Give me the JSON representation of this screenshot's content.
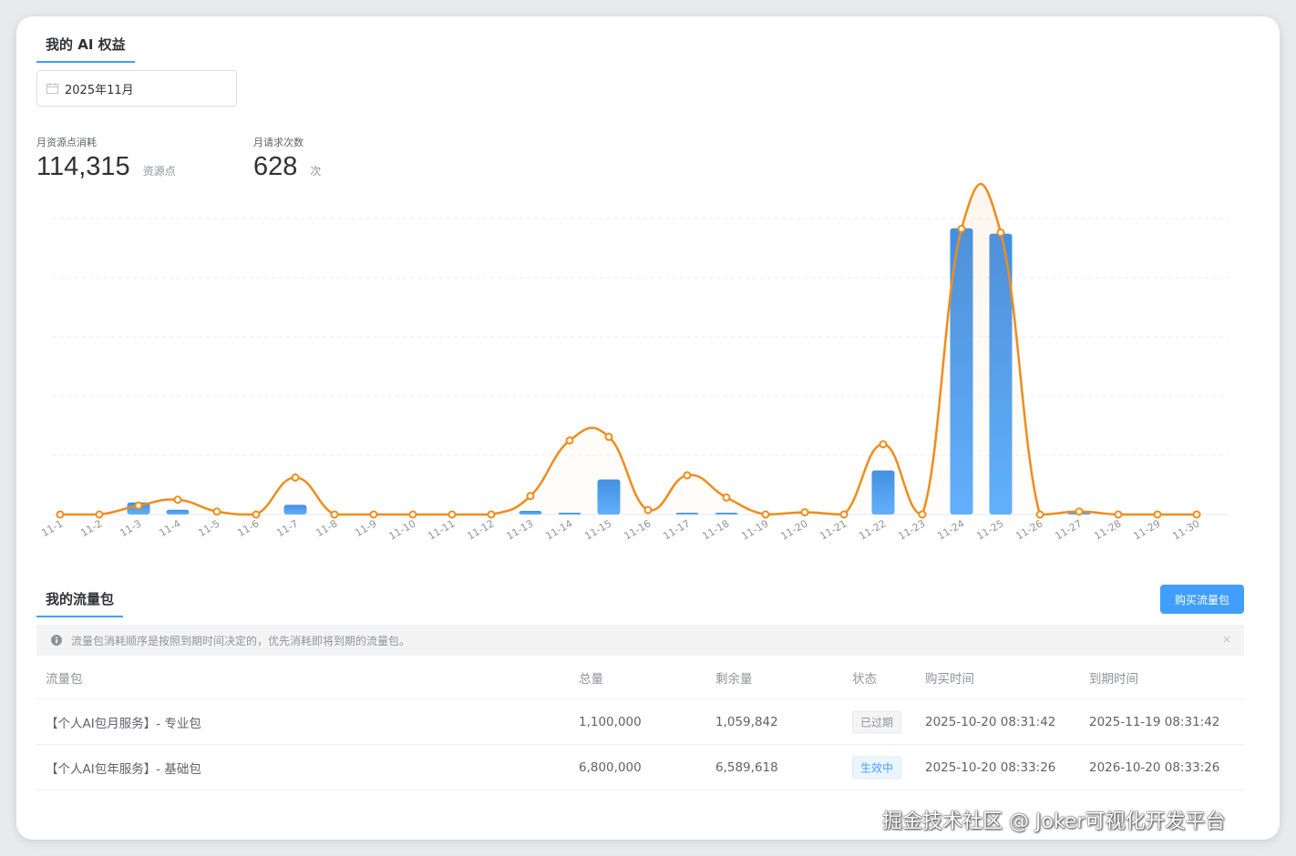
{
  "header": {
    "title": "我的 AI 权益"
  },
  "date_picker": {
    "value": "2025年11月",
    "icon": "calendar-icon"
  },
  "stats": {
    "consume": {
      "label": "月资源点消耗",
      "value": "114,315",
      "unit": "资源点"
    },
    "requests": {
      "label": "月请求次数",
      "value": "628",
      "unit": "次"
    }
  },
  "colors": {
    "bar": "#409eff",
    "line": "#f08c1c",
    "accent": "#409eff"
  },
  "chart_data": {
    "type": "bar",
    "categories": [
      "11-1",
      "11-2",
      "11-3",
      "11-4",
      "11-5",
      "11-6",
      "11-7",
      "11-8",
      "11-9",
      "11-10",
      "11-11",
      "11-12",
      "11-13",
      "11-14",
      "11-15",
      "11-16",
      "11-17",
      "11-18",
      "11-19",
      "11-20",
      "11-21",
      "11-22",
      "11-23",
      "11-24",
      "11-25",
      "11-26",
      "11-27",
      "11-28",
      "11-29",
      "11-30"
    ],
    "series": [
      {
        "type": "bar",
        "values": [
          0,
          0,
          2000,
          800,
          0,
          0,
          1600,
          0,
          0,
          0,
          0,
          0,
          600,
          100,
          5800,
          0,
          50,
          300,
          0,
          0,
          0,
          7300,
          0,
          47400,
          46500,
          0,
          150,
          0,
          0,
          0
        ]
      },
      {
        "type": "line",
        "values": [
          0,
          0,
          12,
          20,
          4,
          0,
          50,
          0,
          0,
          0,
          0,
          0,
          25,
          100,
          105,
          6,
          53,
          23,
          0,
          3,
          0,
          95,
          0,
          386,
          381,
          0,
          4,
          0,
          0,
          0
        ]
      }
    ],
    "grid": true,
    "yaxis_labels": false
  },
  "packages": {
    "title": "我的流量包",
    "buy_label": "购买流量包",
    "notice": "流量包消耗顺序是按照到期时间决定的，优先消耗即将到期的流量包。",
    "close_glyph": "×",
    "columns": [
      "流量包",
      "总量",
      "剩余量",
      "状态",
      "购买时间",
      "到期时间"
    ],
    "rows": [
      {
        "name": "【个人AI包月服务】- 专业包",
        "total": "1,100,000",
        "remain": "1,059,842",
        "status": "已过期",
        "status_type": "expired",
        "buy": "2025-10-20 08:31:42",
        "expire": "2025-11-19 08:31:42"
      },
      {
        "name": "【个人AI包年服务】- 基础包",
        "total": "6,800,000",
        "remain": "6,589,618",
        "status": "生效中",
        "status_type": "active",
        "buy": "2025-10-20 08:33:26",
        "expire": "2026-10-20 08:33:26"
      }
    ]
  },
  "watermark": "掘金技术社区 @ Joker可视化开发平台"
}
